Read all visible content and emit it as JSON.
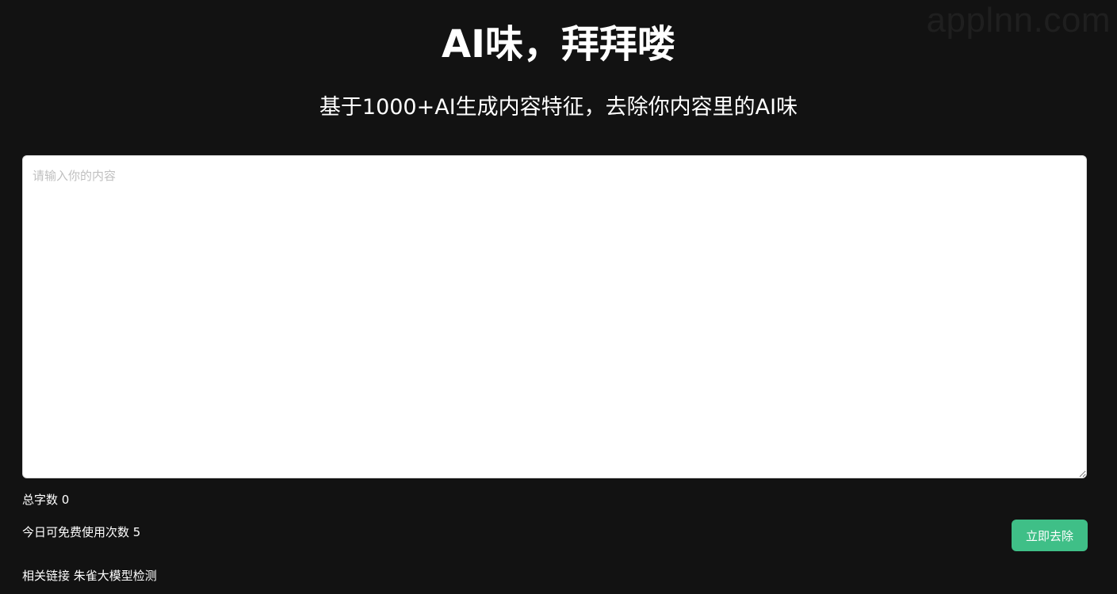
{
  "watermark": "applnn.com",
  "header": {
    "title": "AI味，拜拜喽",
    "subtitle": "基于1000+AI生成内容特征，去除你内容里的AI味"
  },
  "editor": {
    "value": "",
    "placeholder": "请输入你的内容"
  },
  "stats": {
    "word_count_label": "总字数",
    "word_count_value": "0",
    "free_usage_label": "今日可免费使用次数",
    "free_usage_value": "5"
  },
  "actions": {
    "submit_label": "立即去除",
    "submit_color": "#3fbf87"
  },
  "footer": {
    "related_label": "相关链接",
    "related_link": "朱雀大模型检测"
  },
  "colors": {
    "background": "#121212",
    "accent": "#3fbf87"
  }
}
